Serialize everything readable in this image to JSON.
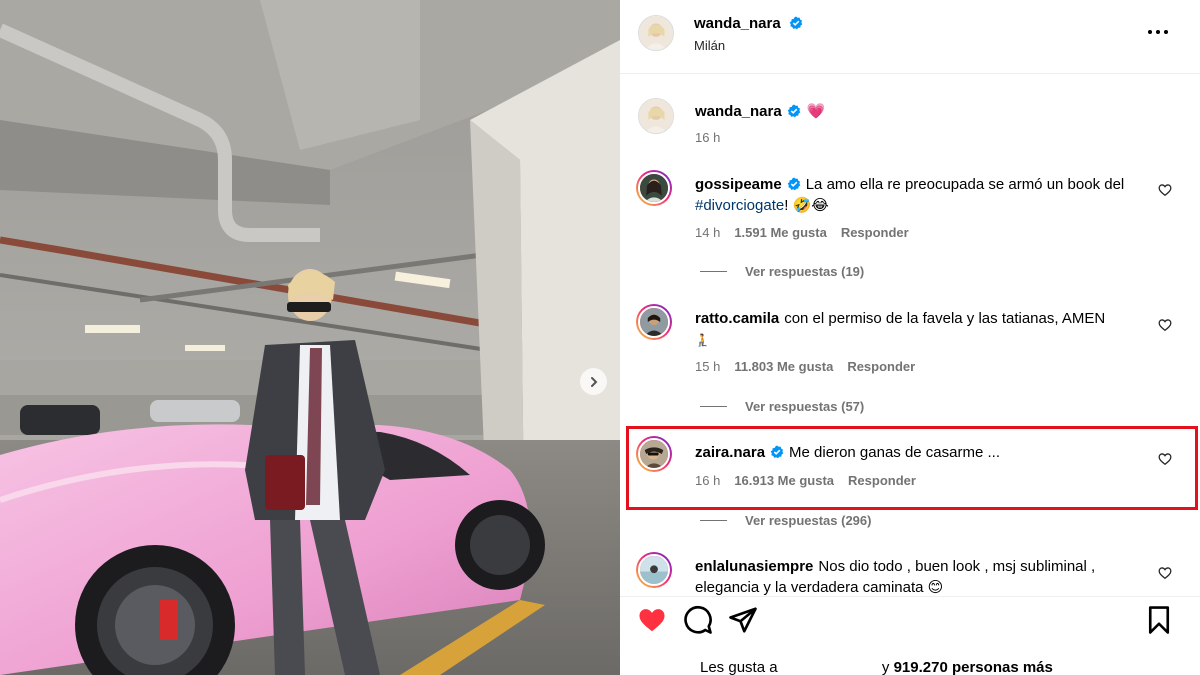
{
  "post": {
    "author": "wanda_nara",
    "location": "Milán",
    "caption_emoji": "💗",
    "caption_time": "16 h"
  },
  "comments": [
    {
      "username": "gossipeame",
      "verified": true,
      "text": "La amo ella re preocupada se armó un book del",
      "hashtag": "#divorciogate",
      "text_end": "! 🤣😂",
      "time": "14 h",
      "likes": "1.591 Me gusta",
      "reply": "Responder",
      "view_replies": "Ver respuestas (19)"
    },
    {
      "username": "ratto.camila",
      "verified": false,
      "text": "con el permiso de la favela y las tatianas, AMEN",
      "text_line2": "🧎",
      "time": "15 h",
      "likes": "11.803 Me gusta",
      "reply": "Responder",
      "view_replies": "Ver respuestas (57)"
    },
    {
      "username": "zaira.nara",
      "verified": true,
      "text": "Me dieron ganas de casarme ...",
      "time": "16 h",
      "likes": "16.913 Me gusta",
      "reply": "Responder",
      "view_replies": "Ver respuestas (296)"
    },
    {
      "username": "enlalunasiempre",
      "verified": false,
      "text": "Nos dio todo , buen look , msj subliminal ,",
      "text_line2": "elegancia y la verdadera caminata 😊"
    }
  ],
  "footer": {
    "liked_by_prefix": "Les gusta a",
    "liked_by_suffix": "y",
    "likes_count": "919.270 personas más"
  },
  "colors": {
    "verified_blue": "#0095f6",
    "heart_red": "#ff3040",
    "highlight_red": "#e3111b",
    "car_pink": "#f2a9d6"
  },
  "icons": {
    "verified": "verified-badge-icon",
    "more": "more-options-icon",
    "like": "heart-outline-icon",
    "liked": "heart-filled-icon",
    "comment": "comment-bubble-icon",
    "share": "paper-plane-icon",
    "save": "bookmark-icon",
    "next": "chevron-right-icon"
  }
}
